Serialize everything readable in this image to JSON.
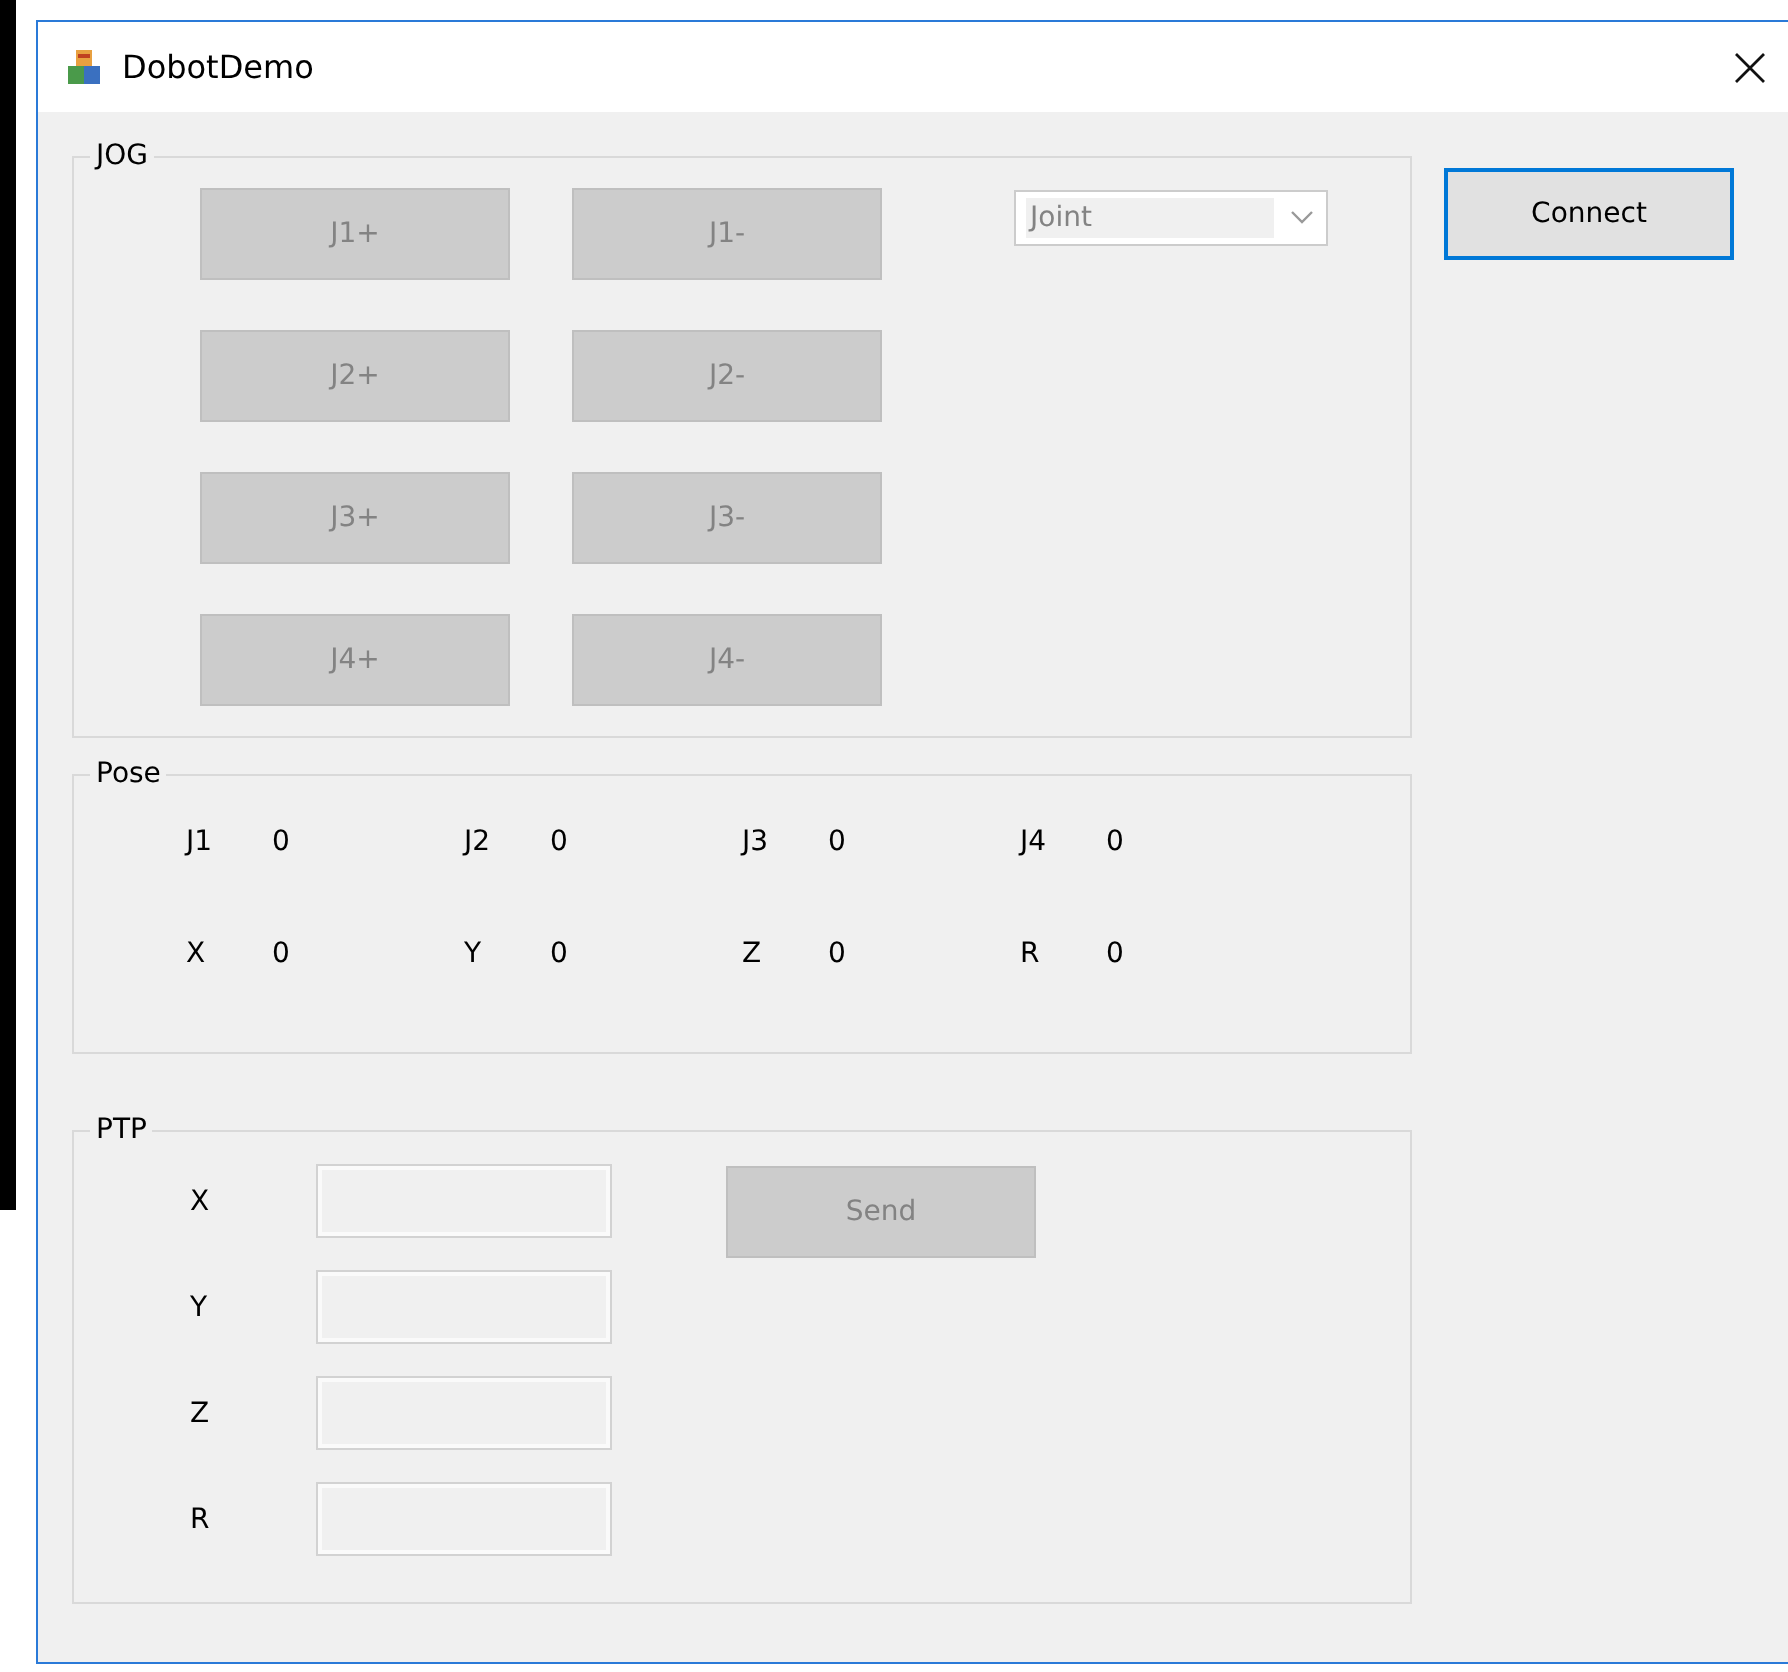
{
  "window": {
    "title": "DobotDemo"
  },
  "jog": {
    "title": "JOG",
    "buttons": [
      {
        "label": "J1+",
        "disabled": true
      },
      {
        "label": "J1-",
        "disabled": true
      },
      {
        "label": "J2+",
        "disabled": true
      },
      {
        "label": "J2-",
        "disabled": true
      },
      {
        "label": "J3+",
        "disabled": true
      },
      {
        "label": "J3-",
        "disabled": true
      },
      {
        "label": "J4+",
        "disabled": true
      },
      {
        "label": "J4-",
        "disabled": true
      }
    ],
    "mode": {
      "value": "Joint",
      "disabled": true
    }
  },
  "connect_button": {
    "label": "Connect",
    "focused": true
  },
  "pose": {
    "title": "Pose",
    "items": [
      {
        "label": "J1",
        "value": "0"
      },
      {
        "label": "J2",
        "value": "0"
      },
      {
        "label": "J3",
        "value": "0"
      },
      {
        "label": "J4",
        "value": "0"
      },
      {
        "label": "X",
        "value": "0"
      },
      {
        "label": "Y",
        "value": "0"
      },
      {
        "label": "Z",
        "value": "0"
      },
      {
        "label": "R",
        "value": "0"
      }
    ]
  },
  "ptp": {
    "title": "PTP",
    "fields": [
      {
        "label": "X"
      },
      {
        "label": "Y"
      },
      {
        "label": "Z"
      },
      {
        "label": "R"
      }
    ],
    "send_button": {
      "label": "Send",
      "disabled": true
    }
  }
}
